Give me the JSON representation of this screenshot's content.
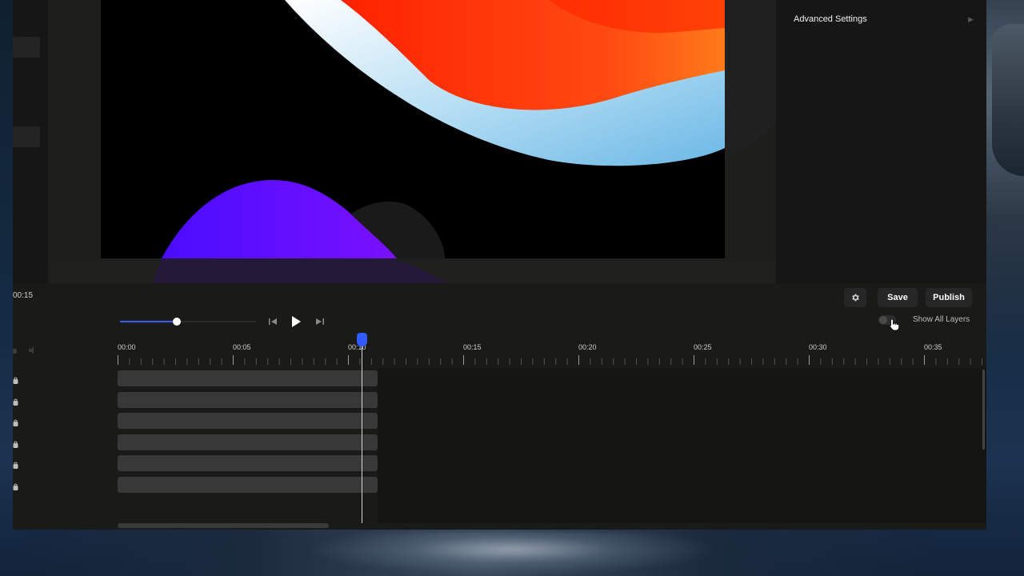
{
  "right_panel": {
    "advanced_settings_label": "Advanced Settings",
    "chevron_icon": "chevron-right-icon"
  },
  "toolbar": {
    "time_readout": "00:15",
    "settings_icon": "gear-icon",
    "save_label": "Save",
    "publish_label": "Publish"
  },
  "playback": {
    "progress": 0.42,
    "prev_icon": "skip-back-icon",
    "play_icon": "play-icon",
    "next_icon": "skip-forward-icon"
  },
  "layers_toggle": {
    "label": "Show All Layers",
    "on": false
  },
  "timeline": {
    "ticks": [
      "00:00",
      "00:05",
      "00:10",
      "00:15",
      "00:20",
      "00:25",
      "00:30",
      "00:35"
    ],
    "playhead_time": "00:10",
    "track_count": 6
  },
  "colors": {
    "accent": "#2f5bff",
    "canvas_shape_orange": "#ff4a12",
    "canvas_shape_blue": "#7cc4ec",
    "canvas_shape_purple": "#6a14ff"
  }
}
